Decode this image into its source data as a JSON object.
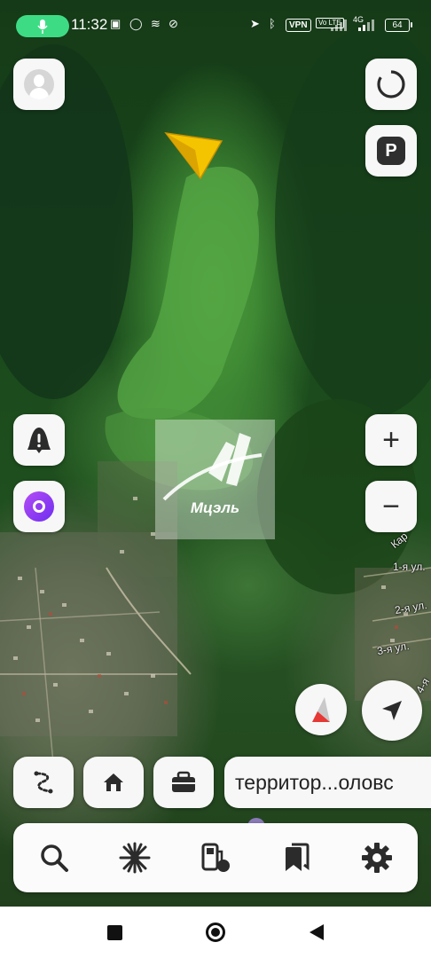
{
  "status_bar": {
    "time": "11:32",
    "vpn": "VPN",
    "volte": "Vo LTE",
    "network": "4G",
    "battery": "64"
  },
  "map": {
    "watermark": "Мцэль",
    "street_labels": [
      "1-я ул.",
      "2-я ул.",
      "3-я ул.",
      "4-я",
      "Кар"
    ]
  },
  "top_controls": {
    "profile_icon": "person-icon",
    "layers_icon": "layers-icon",
    "parking_label": "P"
  },
  "left_controls": {
    "alert_icon": "alert-icon",
    "alice_icon": "alice-icon"
  },
  "zoom": {
    "in_label": "+",
    "out_label": "−"
  },
  "quick_actions": {
    "route_icon": "route-icon",
    "home_icon": "home-icon",
    "work_icon": "briefcase-icon",
    "address": "территор...оловс"
  },
  "tabbar": [
    "search-icon",
    "discover-icon",
    "fuel-icon",
    "bookmarks-icon",
    "settings-icon"
  ],
  "colors": {
    "status_pill": "#3ddc84",
    "navigator_arrow": "#f5c400",
    "compass_red": "#e53935",
    "alice_purple": "#8b3cf7"
  }
}
